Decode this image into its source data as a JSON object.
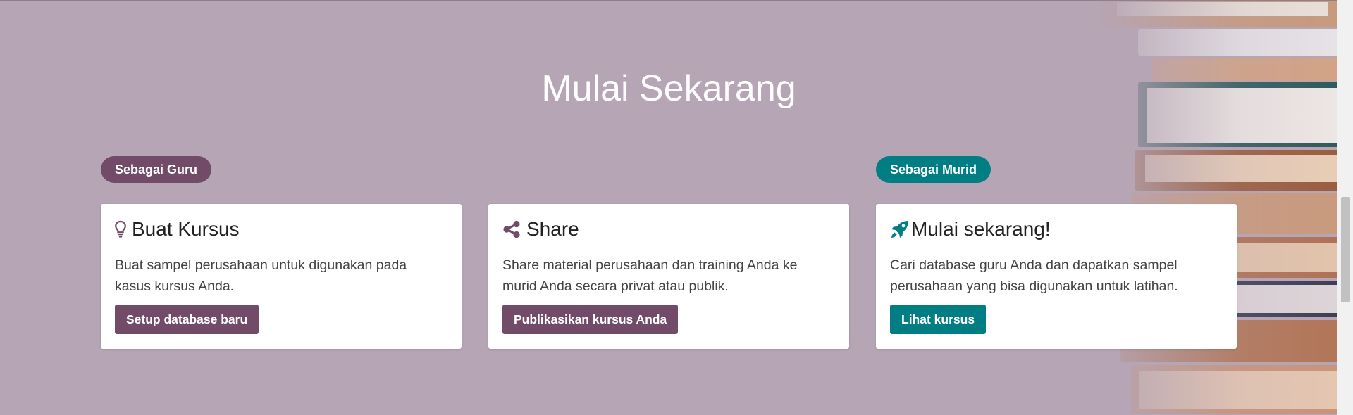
{
  "hero": {
    "title": "Mulai Sekarang"
  },
  "badges": {
    "guru": "Sebagai Guru",
    "murid": "Sebagai Murid"
  },
  "cards": [
    {
      "icon": "lightbulb-icon",
      "title": "Buat Kursus",
      "body": "Buat sampel perusahaan untuk digunakan pada kasus kursus Anda.",
      "button": "Setup database baru"
    },
    {
      "icon": "share-icon",
      "title": "Share",
      "body": "Share material perusahaan dan training Anda ke murid Anda secara privat atau publik.",
      "button": "Publikasikan kursus Anda"
    },
    {
      "icon": "rocket-icon",
      "title": "Mulai sekarang!",
      "body": "Cari database guru Anda dan dapatkan sampel perusahaan yang bisa digunakan untuk latihan.",
      "button": "Lihat kursus"
    }
  ],
  "colors": {
    "background": "#b6a5b4",
    "primary": "#714b67",
    "teal": "#017e84",
    "card": "#ffffff"
  }
}
